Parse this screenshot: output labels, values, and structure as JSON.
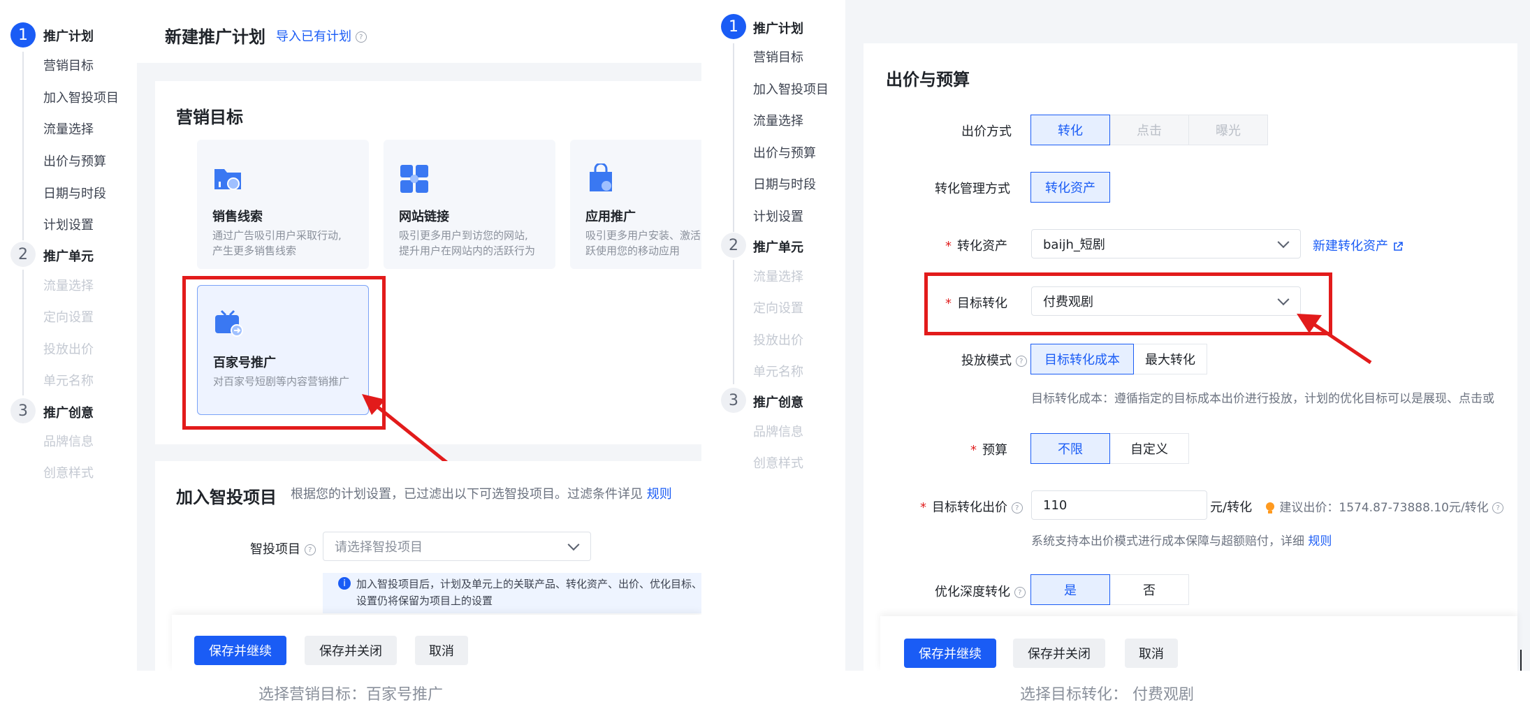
{
  "left": {
    "nav": {
      "step1": {
        "num": "1",
        "title": "推广计划",
        "items": [
          "营销目标",
          "加入智投项目",
          "流量选择",
          "出价与预算",
          "日期与时段",
          "计划设置"
        ]
      },
      "step2": {
        "num": "2",
        "title": "推广单元",
        "items": [
          "流量选择",
          "定向设置",
          "投放出价",
          "单元名称"
        ]
      },
      "step3": {
        "num": "3",
        "title": "推广创意",
        "items": [
          "品牌信息",
          "创意样式"
        ]
      }
    },
    "header": {
      "title": "新建推广计划",
      "import_link": "导入已有计划"
    },
    "marketing": {
      "title": "营销目标",
      "goals": [
        {
          "title": "销售线索",
          "desc1": "通过广告吸引用户采取行动,",
          "desc2": "产生更多销售线索"
        },
        {
          "title": "网站链接",
          "desc1": "吸引更多用户到访您的网站,",
          "desc2": "提升用户在网站内的活跃行为"
        },
        {
          "title": "应用推广",
          "desc1": "吸引更多用户安装、激活",
          "desc2": "跃使用您的移动应用"
        },
        {
          "title": "百家号推广",
          "desc1": "对百家号短剧等内容营销推广",
          "desc2": ""
        }
      ]
    },
    "smart": {
      "title": "加入智投项目",
      "desc": "根据您的计划设置，已过滤出以下可选智投项目。过滤条件详见",
      "rule_link": "规则",
      "field_label": "智投项目",
      "placeholder": "请选择智投项目",
      "info_line1": "加入智投项目后，计划及单元上的关联产品、转化资产、出价、优化目标、",
      "info_line2": "设置仍将保留为项目上的设置"
    },
    "footer": {
      "save_continue": "保存并继续",
      "save_close": "保存并关闭",
      "cancel": "取消"
    },
    "caption": "选择营销目标：百家号推广"
  },
  "right": {
    "nav": {
      "step1": {
        "num": "1",
        "title": "推广计划",
        "items": [
          "营销目标",
          "加入智投项目",
          "流量选择",
          "出价与预算",
          "日期与时段",
          "计划设置"
        ]
      },
      "step2": {
        "num": "2",
        "title": "推广单元",
        "items": [
          "流量选择",
          "定向设置",
          "投放出价",
          "单元名称"
        ]
      },
      "step3": {
        "num": "3",
        "title": "推广创意",
        "items": [
          "品牌信息",
          "创意样式"
        ]
      }
    },
    "section_title": "出价与预算",
    "bid_mode": {
      "label": "出价方式",
      "options": [
        "转化",
        "点击",
        "曝光"
      ]
    },
    "conv_manage": {
      "label": "转化管理方式",
      "option": "转化资产"
    },
    "conv_asset": {
      "label": "转化资产",
      "value": "baijh_短剧",
      "new_link": "新建转化资产"
    },
    "target_conv": {
      "label": "目标转化",
      "value": "付费观剧"
    },
    "delivery_mode": {
      "label": "投放模式",
      "options": [
        "目标转化成本",
        "最大转化"
      ],
      "hint": "目标转化成本：遵循指定的目标成本出价进行投放，计划的优化目标可以是展现、点击或"
    },
    "budget": {
      "label": "预算",
      "options": [
        "不限",
        "自定义"
      ]
    },
    "target_bid": {
      "label": "目标转化出价",
      "value": "110",
      "unit": "元/转化",
      "suggest": "建议出价：1574.87-73888.10元/转化",
      "hint": "系统支持本出价模式进行成本保障与超额赔付，详细",
      "rule_link": "规则"
    },
    "deep_opt": {
      "label": "优化深度转化",
      "options": [
        "是",
        "否"
      ]
    },
    "footer": {
      "save_continue": "保存并继续",
      "save_close": "保存并关闭",
      "cancel": "取消"
    },
    "caption": "选择目标转化：  付费观剧"
  }
}
